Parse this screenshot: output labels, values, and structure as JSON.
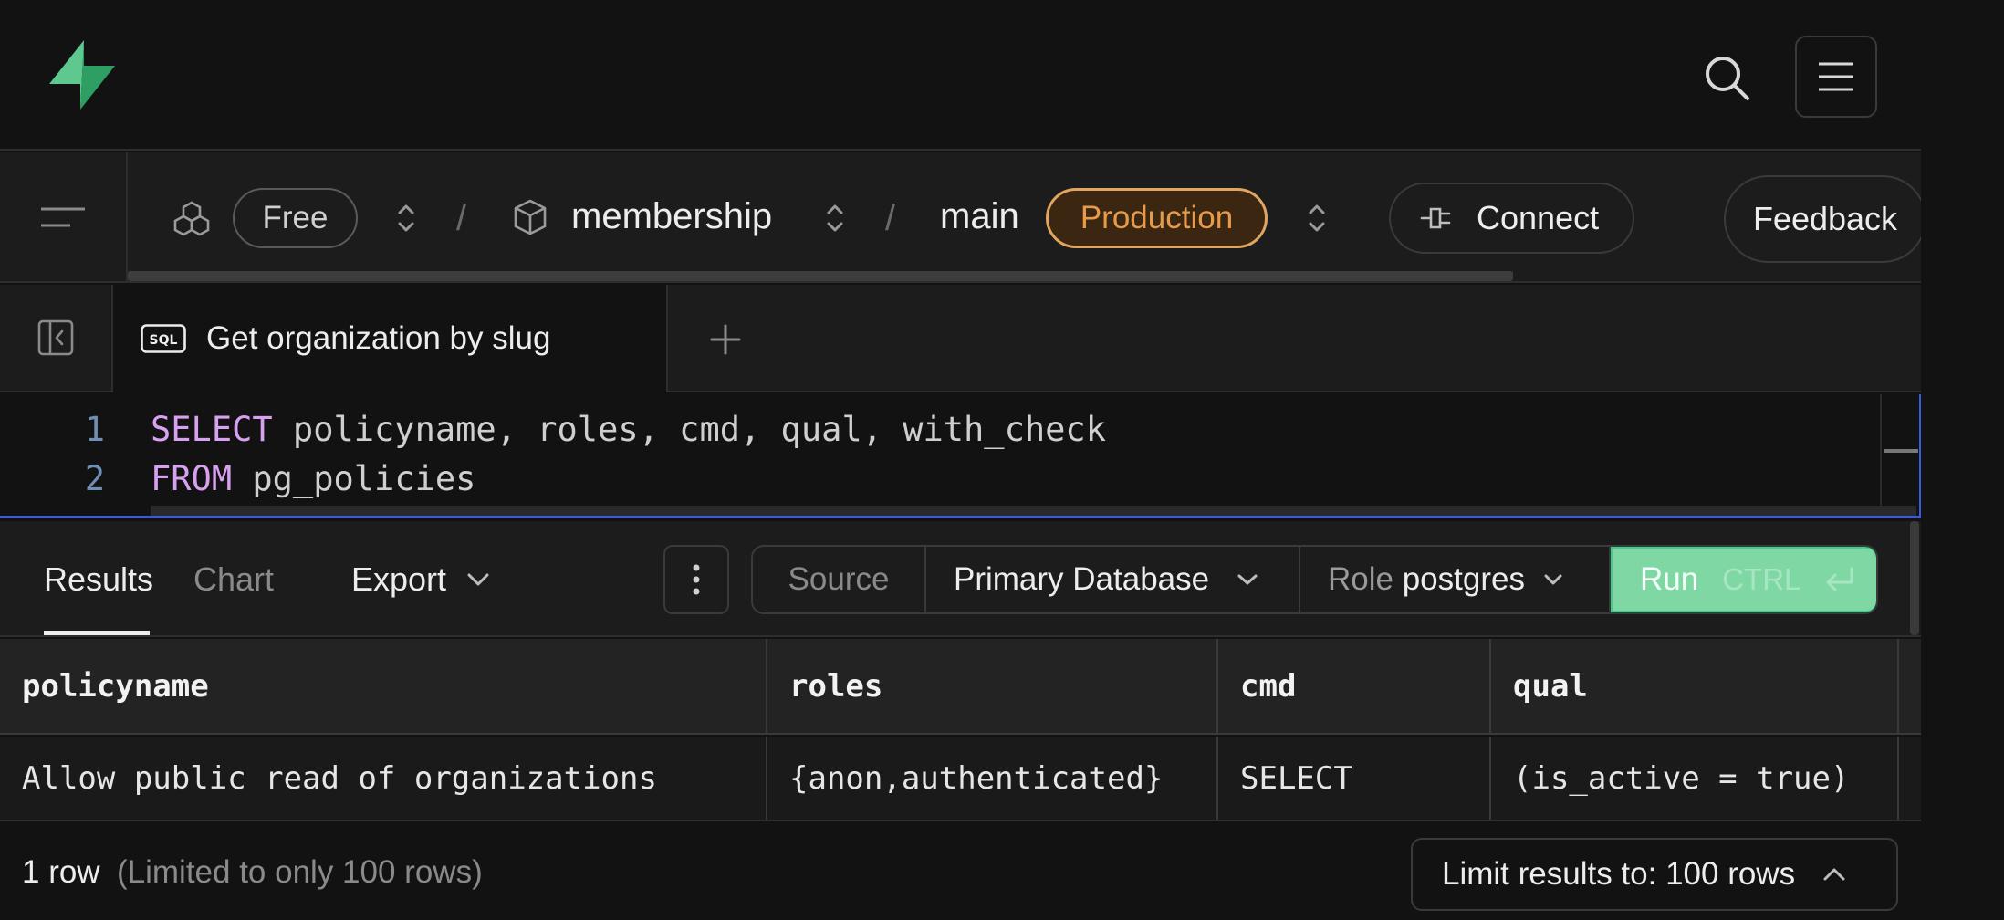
{
  "colors": {
    "brand": "#3ecf8e",
    "production_badge": "#e79a4a",
    "editor_focus": "#3b5bdb",
    "keyword": "#d7a0f0",
    "line_number": "#6f8fb7"
  },
  "header": {
    "logo_icon": "supabase-bolt-icon",
    "search_icon": "search-icon",
    "menu_icon": "hamburger-menu-icon"
  },
  "breadcrumb": {
    "organization_icon": "cubes-icon",
    "plan": "Free",
    "separator": "/",
    "project_icon": "box-icon",
    "project": "membership",
    "branch": "main",
    "environment": "Production",
    "connect_label": "Connect",
    "connect_icon": "plug-icon",
    "feedback_label": "Feedback"
  },
  "tabs": {
    "active_tab": {
      "badge": "SQL",
      "label": "Get organization by slug"
    },
    "new_tab_icon": "plus-icon"
  },
  "editor": {
    "lines": [
      {
        "number": "1",
        "keyword": "SELECT",
        "code": " policyname, roles, cmd, qual, with_check"
      },
      {
        "number": "2",
        "keyword": "FROM",
        "code": " pg_policies"
      }
    ]
  },
  "results_toolbar": {
    "tabs": [
      "Results",
      "Chart"
    ],
    "active_tab": "Results",
    "export_label": "Export",
    "source_label": "Source",
    "database_label": "Primary Database",
    "role_prefix": "Role",
    "role_value": "postgres",
    "run_label": "Run",
    "run_shortcut": "CTRL"
  },
  "results_table": {
    "columns": [
      "policyname",
      "roles",
      "cmd",
      "qual"
    ],
    "rows": [
      [
        "Allow public read of organizations",
        "{anon,authenticated}",
        "SELECT",
        "(is_active = true)"
      ]
    ]
  },
  "footer": {
    "row_count": "1 row",
    "limit_note": "(Limited to only 100 rows)",
    "limit_button": "Limit results to: 100 rows"
  }
}
